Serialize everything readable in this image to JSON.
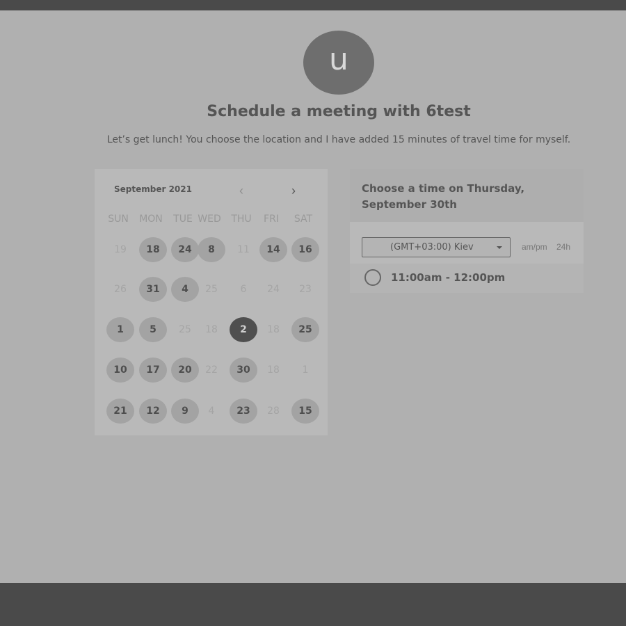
{
  "header": {
    "avatar_letter": "u",
    "title": "Schedule a meeting with 6test",
    "description": "Let’s get lunch! You choose the location and I have added 15 minutes of travel time for myself."
  },
  "calendar": {
    "month_label": "September 2021",
    "prev_icon": "‹",
    "next_icon": "›",
    "weekdays": [
      "SUN",
      "MON",
      "TUE",
      "WED",
      "THU",
      "FRI",
      "SAT"
    ],
    "weeks": [
      [
        {
          "d": "19",
          "s": "unavail"
        },
        {
          "d": "18",
          "s": "avail"
        },
        {
          "d": "24",
          "s": "avail"
        },
        {
          "d": "8",
          "s": "avail"
        },
        {
          "d": "11",
          "s": "unavail"
        },
        {
          "d": "14",
          "s": "avail"
        },
        {
          "d": "16",
          "s": "avail"
        }
      ],
      [
        {
          "d": "26",
          "s": "unavail"
        },
        {
          "d": "31",
          "s": "avail"
        },
        {
          "d": "4",
          "s": "avail"
        },
        {
          "d": "25",
          "s": "unavail"
        },
        {
          "d": "6",
          "s": "unavail"
        },
        {
          "d": "24",
          "s": "unavail"
        },
        {
          "d": "23",
          "s": "unavail"
        }
      ],
      [
        {
          "d": "1",
          "s": "avail"
        },
        {
          "d": "5",
          "s": "avail"
        },
        {
          "d": "25",
          "s": "unavail"
        },
        {
          "d": "18",
          "s": "unavail"
        },
        {
          "d": "2",
          "s": "selected"
        },
        {
          "d": "18",
          "s": "unavail"
        },
        {
          "d": "25",
          "s": "avail"
        }
      ],
      [
        {
          "d": "10",
          "s": "avail"
        },
        {
          "d": "17",
          "s": "avail"
        },
        {
          "d": "20",
          "s": "avail"
        },
        {
          "d": "22",
          "s": "unavail"
        },
        {
          "d": "30",
          "s": "avail"
        },
        {
          "d": "18",
          "s": "unavail"
        },
        {
          "d": "1",
          "s": "unavail"
        }
      ],
      [
        {
          "d": "21",
          "s": "avail"
        },
        {
          "d": "12",
          "s": "avail"
        },
        {
          "d": "9",
          "s": "avail"
        },
        {
          "d": "4",
          "s": "unavail"
        },
        {
          "d": "23",
          "s": "avail"
        },
        {
          "d": "28",
          "s": "unavail"
        },
        {
          "d": "15",
          "s": "avail"
        }
      ]
    ]
  },
  "time_panel": {
    "heading_line1": "Choose a time on Thursday,",
    "heading_line2": "September 30th",
    "timezone": "(GMT+03:00) Kiev",
    "format_ampm": "am/pm",
    "format_24h": "24h",
    "slots": [
      "11:00am - 12:00pm"
    ]
  }
}
